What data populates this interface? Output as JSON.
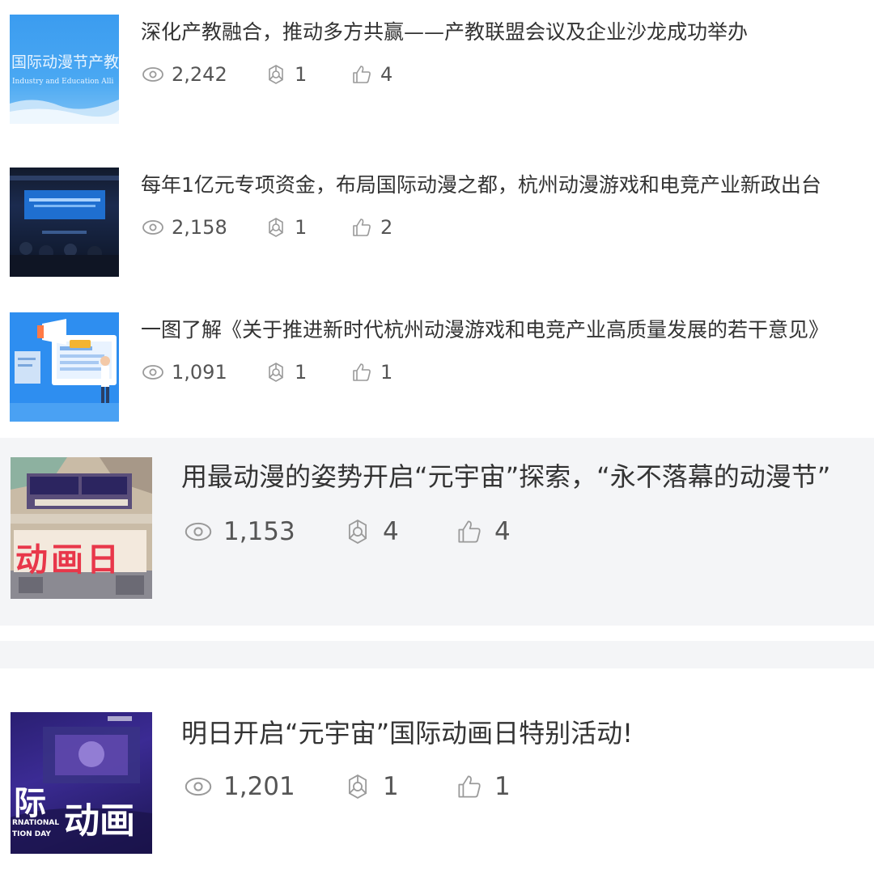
{
  "articles": [
    {
      "title": "深化产教融合，推动多方共赢——产教联盟会议及企业沙龙成功举办",
      "views": "2,242",
      "shares": "1",
      "likes": "4",
      "thumb": {
        "text1": "国际动漫节产教",
        "text2": "Industry and Education Alli"
      }
    },
    {
      "title": "每年1亿元专项资金，布局国际动漫之都，杭州动漫游戏和电竞产业新政出台",
      "views": "2,158",
      "shares": "1",
      "likes": "2",
      "thumb": {}
    },
    {
      "title": "一图了解《关于推进新时代杭州动漫游戏和电竞产业高质量发展的若干意见》",
      "views": "1,091",
      "shares": "1",
      "likes": "1",
      "thumb": {}
    },
    {
      "title": "用最动漫的姿势开启“元宇宙”探索，“永不落幕的动漫节”",
      "views": "1,153",
      "shares": "4",
      "likes": "4",
      "thumb": {
        "text1": "动画日"
      }
    },
    {
      "title": "明日开启“元宇宙”国际动画日特别活动!",
      "views": "1,201",
      "shares": "1",
      "likes": "1",
      "thumb": {
        "text1": "际",
        "text2": "动画",
        "text3": "RNATIONAL",
        "text4": "TION DAY"
      }
    }
  ],
  "icons": {
    "views": "eye-icon",
    "shares": "share-icon",
    "likes": "thumbs-up-icon"
  },
  "colors": {
    "text": "#333333",
    "meta": "#555555",
    "icon": "#9a9a9a",
    "band": "#f4f5f7"
  }
}
